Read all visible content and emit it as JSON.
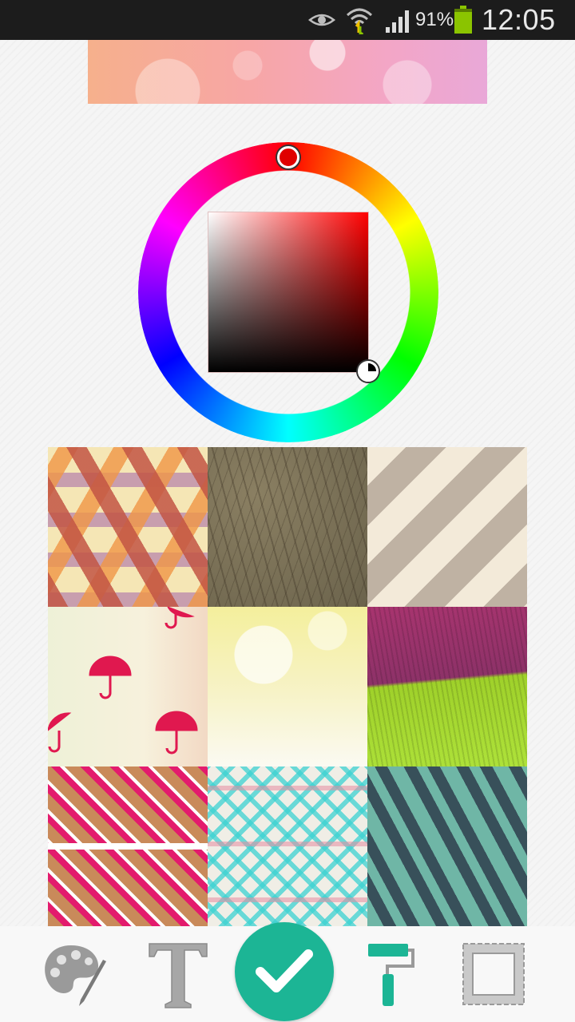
{
  "status_bar": {
    "battery_percent": "91%",
    "time": "12:05",
    "icons": [
      "eye-icon",
      "wifi-data-icon",
      "signal-icon",
      "battery-icon"
    ]
  },
  "color_picker": {
    "selected_hue": "#ff0000",
    "selected_color": "#000000"
  },
  "patterns": [
    "geometric-hexagon-pattern",
    "brown-tree-texture",
    "beige-diagonal-stripes",
    "pink-umbrella-pattern",
    "yellow-bokeh-light",
    "magenta-lime-canvas",
    "pink-tribal-diamonds",
    "aqua-tribal-pattern",
    "teal-zebra-stripes"
  ],
  "toolbar": {
    "items": [
      "palette-icon",
      "text-icon",
      "confirm-icon",
      "paint-roller-icon",
      "frame-icon"
    ],
    "accent": "#1cb595"
  }
}
